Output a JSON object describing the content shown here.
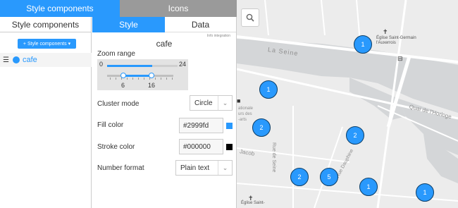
{
  "tabs": {
    "style_components": "Style components",
    "icons": "Icons"
  },
  "left": {
    "header": "Style components",
    "add_button": "Style components",
    "add_icon": "plus-icon",
    "layers": [
      {
        "name": "cafe",
        "color": "#2999fd"
      }
    ]
  },
  "editor": {
    "tabs": {
      "style": "Style",
      "data": "Data"
    },
    "info_link": "Info integration",
    "layer_title": "cafe",
    "zoom": {
      "label": "Zoom range",
      "min": "0",
      "max": "24",
      "from": "6",
      "to": "16"
    },
    "cluster_mode": {
      "label": "Cluster mode",
      "value": "Circle"
    },
    "fill_color": {
      "label": "Fill color",
      "value": "#2999fd"
    },
    "stroke_color": {
      "label": "Stroke color",
      "value": "#000000"
    },
    "number_format": {
      "label": "Number format",
      "value": "Plain text"
    }
  },
  "map": {
    "labels": {
      "la_seine": "La Seine",
      "eglise_top_1": "Église Saint-Germain",
      "eglise_top_2": "l'Auxerrois",
      "quai_horloge": "Quai de l'Horloge",
      "nationale_1": "ationale",
      "nationale_2": "urs des",
      "nationale_3": "-arts",
      "rue_seine": "Rue de Seine",
      "rue_dauphine": "Rue Dauphine",
      "jacob": "Jacob",
      "eglise_bottom": "Église Saint-"
    },
    "clusters": [
      "1",
      "1",
      "2",
      "2",
      "2",
      "5",
      "1",
      "1"
    ],
    "accent": "#2999fd"
  }
}
